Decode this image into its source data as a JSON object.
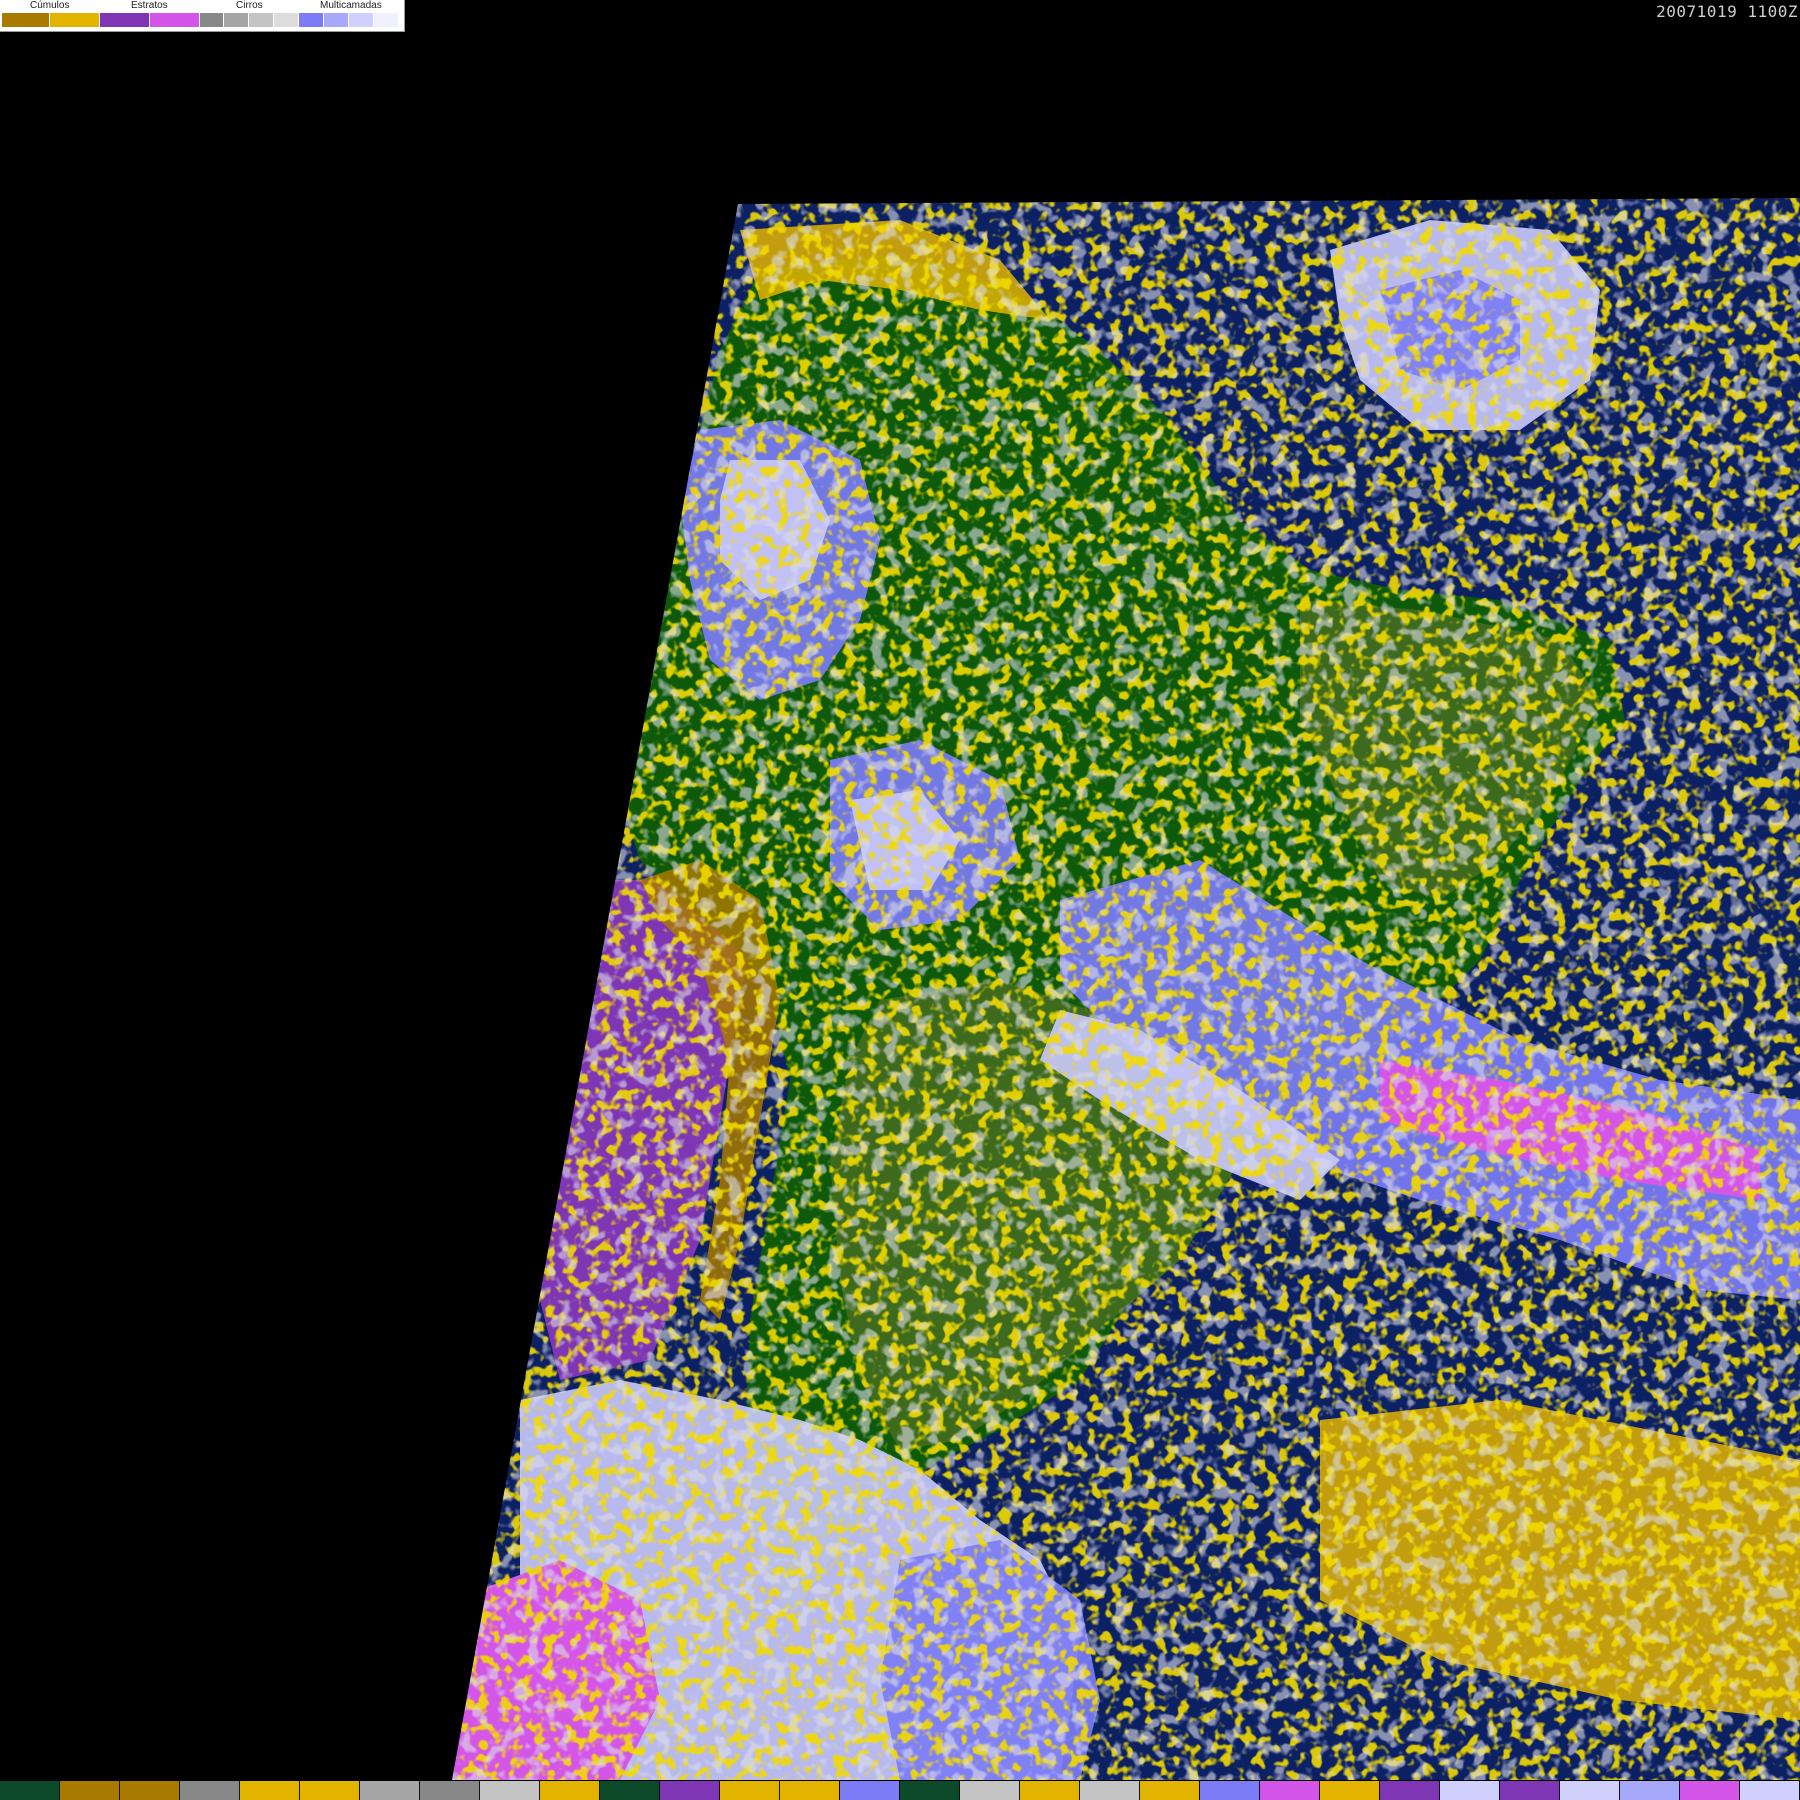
{
  "timestamp": "20071019 1100Z",
  "legend": {
    "groups": [
      {
        "label": "Cúmulos"
      },
      {
        "label": "Estratos"
      },
      {
        "label": "Cirros"
      },
      {
        "label": "Multicamadas"
      }
    ],
    "swatches": [
      {
        "color": "#a87a00",
        "group": "Cúmulos"
      },
      {
        "color": "#e2b400",
        "group": "Cúmulos"
      },
      {
        "color": "#7e36b4",
        "group": "Estratos"
      },
      {
        "color": "#d456e8",
        "group": "Estratos"
      },
      {
        "color": "#888888",
        "group": "Cirros"
      },
      {
        "color": "#a6a6a6",
        "group": "Cirros"
      },
      {
        "color": "#c4c4c4",
        "group": "Cirros"
      },
      {
        "color": "#dcdcdc",
        "group": "Cirros"
      },
      {
        "color": "#7c7cf6",
        "group": "Multicamadas"
      },
      {
        "color": "#a8a8fa",
        "group": "Multicamadas"
      },
      {
        "color": "#d0d0fc",
        "group": "Multicamadas"
      },
      {
        "color": "#f0f0ff",
        "group": "Multicamadas"
      }
    ]
  },
  "map_colors": {
    "background": "#000000",
    "ocean": "#0c2064",
    "forest": "#0e5a0a",
    "land": "#3e6a1e",
    "cumulus_low": "#a87a00",
    "cumulus_high": "#e2b400",
    "stratus": "#7e36b4",
    "stratus_light": "#d456e8",
    "cirrus": "#a6a6a6",
    "multilayer": "#7c7cf6",
    "multilayer_light": "#c8c8fa"
  },
  "bottom_bar": [
    "#0c4a2a",
    "#a87a00",
    "#a87a00",
    "#888888",
    "#e2b400",
    "#e2b400",
    "#a6a6a6",
    "#888888",
    "#c4c4c4",
    "#e2b400",
    "#0c4a2a",
    "#7e36b4",
    "#e2b400",
    "#e2b400",
    "#7c7cf6",
    "#0c4a2a",
    "#c4c4c4",
    "#e2b400",
    "#c4c4c4",
    "#e2b400",
    "#7c7cf6",
    "#d456e8",
    "#e2b400",
    "#7e36b4",
    "#d0d0fc",
    "#7e36b4",
    "#d0d0fc",
    "#a8a8fa",
    "#d456e8",
    "#d0d0fc"
  ]
}
